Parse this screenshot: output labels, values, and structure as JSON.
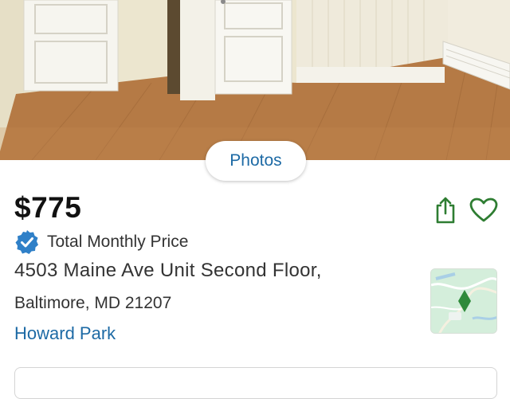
{
  "gallery": {
    "photos_button_label": "Photos"
  },
  "listing": {
    "price": "$775",
    "price_type_label": "Total Monthly Price",
    "address_line1": "4503 Maine Ave Unit Second Floor,",
    "address_line2": "Baltimore, MD 21207",
    "neighborhood": "Howard Park"
  },
  "icons": {
    "verified": "verified-check-icon",
    "share": "share-icon",
    "favorite": "heart-icon",
    "map": "map-pin-icon"
  },
  "colors": {
    "link_blue": "#1d6aa5",
    "verified_blue": "#2f80c8",
    "action_green": "#2e7d32",
    "map_pin_green": "#2f8a3a"
  }
}
